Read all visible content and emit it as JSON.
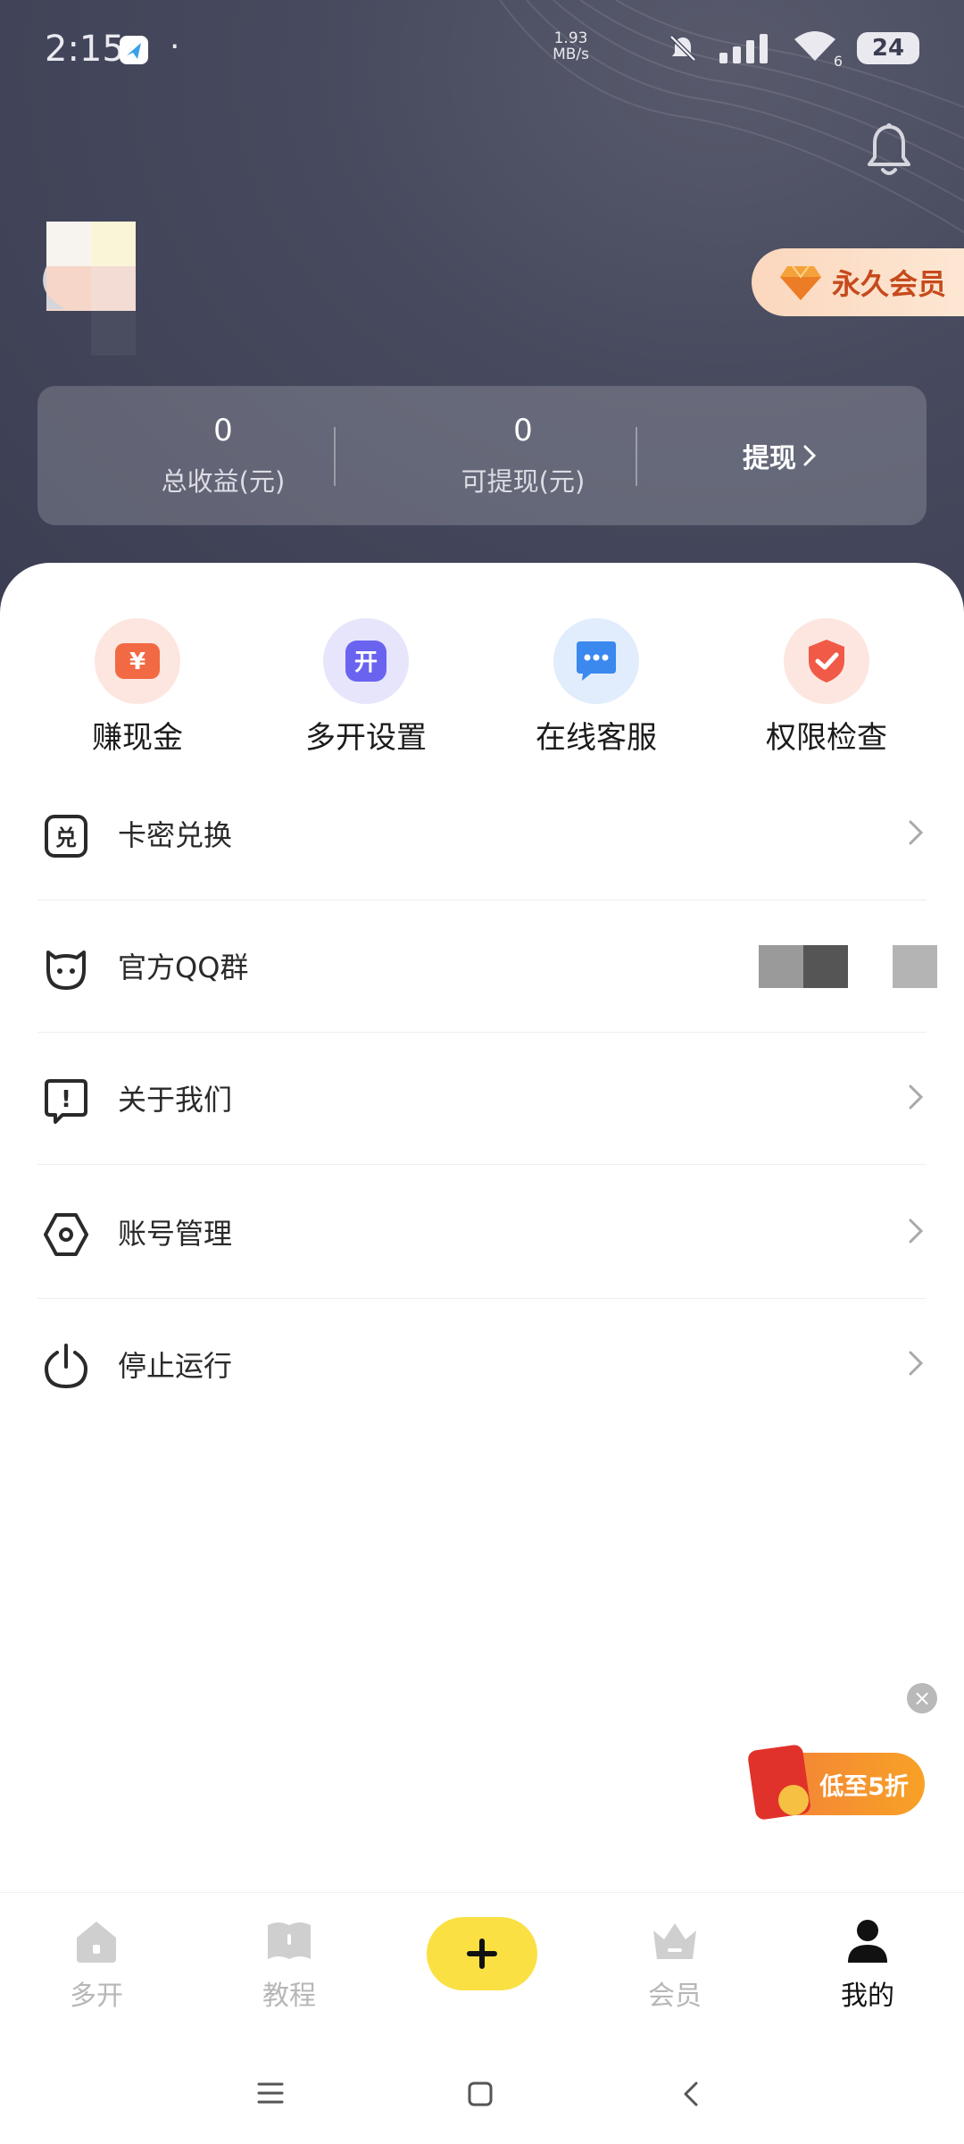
{
  "status_bar": {
    "time": "2:15",
    "dot": "·",
    "net_speed_value": "1.93",
    "net_speed_unit": "MB/s",
    "wifi_label": "6",
    "battery": "24"
  },
  "header": {
    "vip_badge": "永久会员"
  },
  "earnings": {
    "total_value": "0",
    "total_label": "总收益(元)",
    "withdrawable_value": "0",
    "withdrawable_label": "可提现(元)",
    "withdraw_button": "提现"
  },
  "quick_actions": [
    {
      "label": "赚现金",
      "icon": "yen-icon",
      "glyph": "¥",
      "bg": "#fde6e0",
      "fg": "#f26a43"
    },
    {
      "label": "多开设置",
      "icon": "multi-open-icon",
      "glyph": "开",
      "bg": "#e6e5fb",
      "fg": "#6a63f0"
    },
    {
      "label": "在线客服",
      "icon": "chat-icon",
      "glyph": "···",
      "bg": "#e1edfc",
      "fg": "#3b88ee"
    },
    {
      "label": "权限检查",
      "icon": "shield-check-icon",
      "glyph": "✓",
      "bg": "#fde6e0",
      "fg": "#f05a46"
    }
  ],
  "menu": [
    {
      "label": "卡密兑换",
      "icon": "redeem-icon",
      "icon_glyph": "兑"
    },
    {
      "label": "官方QQ群",
      "icon": "qq-icon"
    },
    {
      "label": "关于我们",
      "icon": "info-bubble-icon",
      "icon_glyph": "!"
    },
    {
      "label": "账号管理",
      "icon": "settings-hex-icon"
    },
    {
      "label": "停止运行",
      "icon": "power-icon"
    }
  ],
  "promo": {
    "close": "×",
    "label": "低至5折"
  },
  "tabs": [
    {
      "label": "多开",
      "icon": "home-icon"
    },
    {
      "label": "教程",
      "icon": "book-icon"
    },
    {
      "label": "会员",
      "icon": "crown-icon"
    },
    {
      "label": "我的",
      "icon": "profile-icon"
    }
  ],
  "colors": {
    "header_bg": "#3b3e52",
    "accent_yellow": "#fbe044",
    "vip_text": "#c64a1c",
    "promo_orange": "#f2803a"
  }
}
